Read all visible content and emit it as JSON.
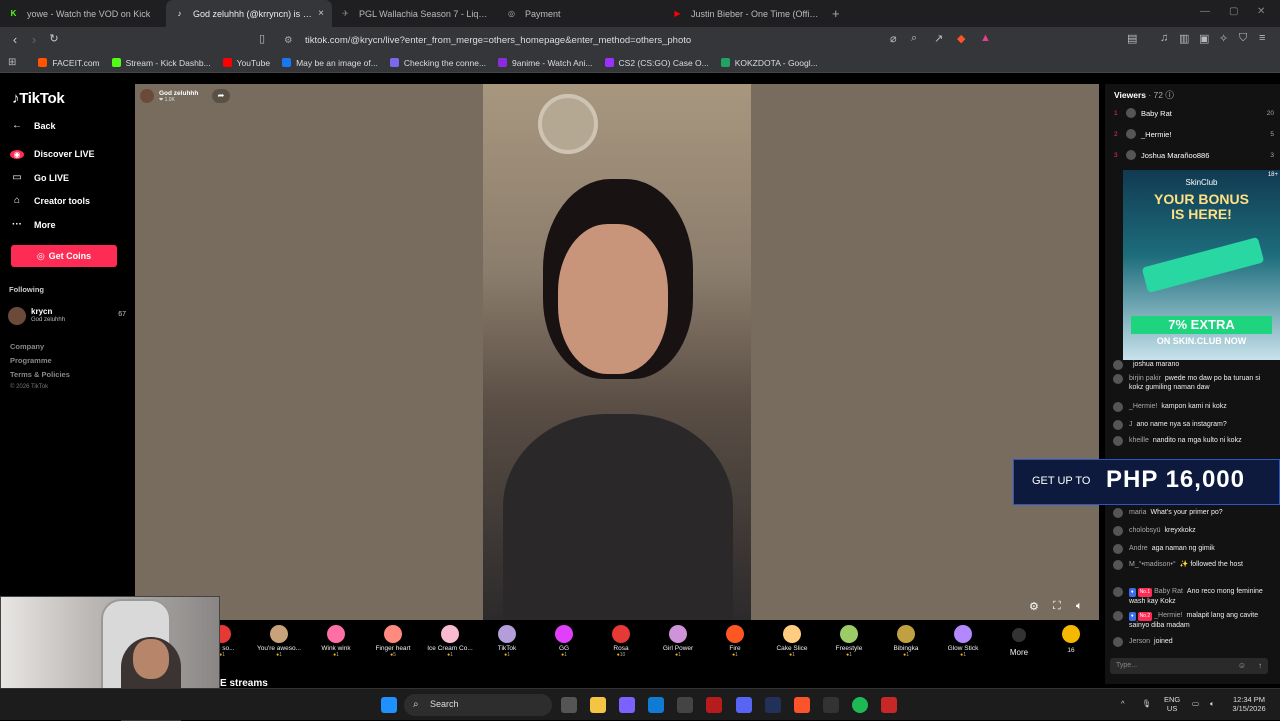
{
  "tabs": [
    {
      "title": "yowe - Watch the VOD on Kick",
      "icon": "kick-icon",
      "color": "#53fc18",
      "glyph": "K"
    },
    {
      "title": "God zeluhhh (@krryncn) is LIVE",
      "icon": "tiktok-icon",
      "color": "#ffffff",
      "glyph": "♪",
      "active": true
    },
    {
      "title": "PGL Wallachia Season 7 - Liquipedia",
      "icon": "liquipedia-icon",
      "color": "#888888",
      "glyph": "✈"
    },
    {
      "title": "Payment",
      "icon": "globe-icon",
      "color": "#aaaaaa",
      "glyph": "◎"
    },
    {
      "title": "Justin Bieber - One Time (Official Mu...",
      "icon": "youtube-icon",
      "color": "#ff0000",
      "glyph": "▶"
    }
  ],
  "url": "tiktok.com/@krycn/live?enter_from_merge=others_homepage&enter_method=others_photo",
  "bookmarks": [
    {
      "label": "FACEIT.com",
      "color": "#ff5500"
    },
    {
      "label": "Stream - Kick Dashb...",
      "color": "#53fc18"
    },
    {
      "label": "YouTube",
      "color": "#ff0000"
    },
    {
      "label": "May be an image of...",
      "color": "#1877f2"
    },
    {
      "label": "Checking the conne...",
      "color": "#7b68ee"
    },
    {
      "label": "9anime - Watch Ani...",
      "color": "#8a2be2"
    },
    {
      "label": "CS2 (CS:GO) Case O...",
      "color": "#9b30ff"
    },
    {
      "label": "KOKZDOTA - Googl...",
      "color": "#21a366"
    }
  ],
  "sidebar": {
    "logo": "TikTok",
    "back": "Back",
    "discover": "Discover LIVE",
    "golive": "Go LIVE",
    "creator": "Creator tools",
    "more": "More",
    "get_coins": "Get Coins",
    "following": "Following",
    "followed_user": {
      "name": "krycn",
      "sub": "God zeluhhh",
      "count": "67"
    },
    "footer": [
      "Company",
      "Programme",
      "Terms & Policies"
    ],
    "copyright": "© 2026 TikTok"
  },
  "stream": {
    "host_name": "God zeluhhh",
    "host_sub": "❤ 1.0K"
  },
  "gifts": [
    {
      "name": "You so...",
      "price": "1",
      "color": "#e53935"
    },
    {
      "name": "You're aweso...",
      "price": "1",
      "color": "#c8a27a"
    },
    {
      "name": "Wink wink",
      "price": "1",
      "color": "#ff6fa5"
    },
    {
      "name": "Finger heart",
      "price": "5",
      "color": "#ff8a80"
    },
    {
      "name": "Ice Cream Co...",
      "price": "1",
      "color": "#f8bbd0"
    },
    {
      "name": "TikTok",
      "price": "1",
      "color": "#b39ddb"
    },
    {
      "name": "GG",
      "price": "1",
      "color": "#e040fb"
    },
    {
      "name": "Rosa",
      "price": "10",
      "color": "#e53935"
    },
    {
      "name": "Girl Power",
      "price": "1",
      "color": "#ce93d8"
    },
    {
      "name": "Fire",
      "price": "1",
      "color": "#ff5722"
    },
    {
      "name": "Cake Slice",
      "price": "1",
      "color": "#ffcc80"
    },
    {
      "name": "Freestyle",
      "price": "1",
      "color": "#9ccc65"
    },
    {
      "name": "Bibingka",
      "price": "1",
      "color": "#c0a040"
    },
    {
      "name": "Glow Stick",
      "price": "1",
      "color": "#b388ff"
    }
  ],
  "gift_more": "More",
  "coin_count": "16",
  "streams_title": "E streams",
  "viewers": {
    "title": "Viewers",
    "count": "· 72",
    "list": [
      {
        "rank": "1",
        "name": "Baby Rat",
        "num": "20"
      },
      {
        "rank": "2",
        "name": "_Hermie!",
        "num": "5"
      },
      {
        "rank": "3",
        "name": "Joshua Marañoo886",
        "num": "3"
      }
    ]
  },
  "ad": {
    "brand": "SkinClub",
    "headline1": "YOUR BONUS",
    "headline2": "IS HERE!",
    "pct": "7% EXTRA",
    "cta": "ON SKIN.CLUB NOW",
    "age": "18+"
  },
  "chat": [
    {
      "name": "",
      "text": "joshua marano"
    },
    {
      "name": "birjin pakir",
      "text": "pwede mo daw po ba turuan si kokz gumiling naman daw"
    },
    {
      "name": "_Hermie!",
      "text": "kampon kami ni kokz"
    },
    {
      "name": "J",
      "text": "ano name nya sa instagram?"
    },
    {
      "name": "kheille",
      "text": "nandito na mga kulto ni kokz"
    },
    {
      "name": "maria",
      "text": "What's your primer po?"
    },
    {
      "name": "cholobsyü",
      "text": "kreyxkokz"
    },
    {
      "name": "Andre",
      "text": "aga naman ng gimik"
    },
    {
      "name": "M_°•madison•°",
      "text": "✨ followed the host"
    },
    {
      "name": "Baby Rat",
      "text": "Ano reco mong feminine wash kay Kokz",
      "badge": "No.1"
    },
    {
      "name": "_Hermie!",
      "text": "malapit lang ang cavite sainyo diba madam",
      "badge": "No.2"
    },
    {
      "name": "Jerson",
      "text": "joined"
    }
  ],
  "banner": {
    "pre": "GET UP TO",
    "amount": "PHP 16,000"
  },
  "chat_placeholder": "Type...",
  "taskbar": {
    "search": "Search",
    "lang": "ENG",
    "region": "US",
    "time": "12:34 PM",
    "date": "3/15/2026"
  }
}
